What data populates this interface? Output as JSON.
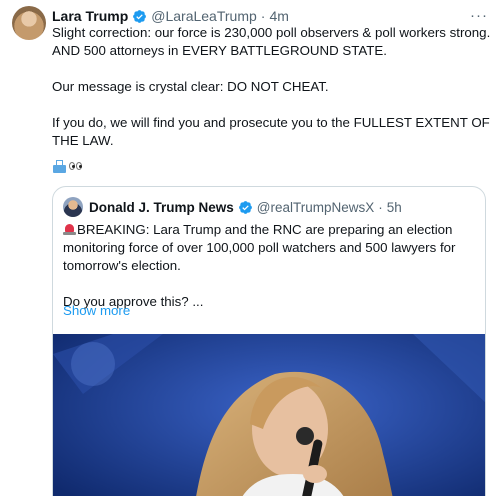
{
  "tweet": {
    "author_name": "Lara Trump",
    "author_handle": "@LaraLeaTrump",
    "separator": "·",
    "time": "4m",
    "more_label": "···",
    "text": "Slight correction: our force is 230,000 poll observers & poll workers strong.\nAND 500 attorneys in EVERY BATTLEGROUND STATE.\n\nOur message is crystal clear: DO NOT CHEAT.\n\nIf you do, we will find you and prosecute you to the FULLEST EXTENT OF THE LAW.",
    "emojis": [
      "ballot-box",
      "eyes"
    ]
  },
  "quote": {
    "author_name": "Donald J. Trump News",
    "author_handle": "@realTrumpNewsX",
    "separator": "·",
    "time": "5h",
    "text_lead_emoji": "police-siren",
    "text": "BREAKING: Lara Trump and the RNC are preparing an election monitoring force of over 100,000 poll watchers and 500 lawyers for tomorrow's election.\n\nDo you approve this? ...",
    "show_more_label": "Show more"
  },
  "colors": {
    "accent": "#1d9bf0",
    "text_primary": "#0f1419",
    "text_secondary": "#536471",
    "border": "#cfd9de",
    "verified": "#1d9bf0",
    "photo_background": "#1b3a8a"
  }
}
